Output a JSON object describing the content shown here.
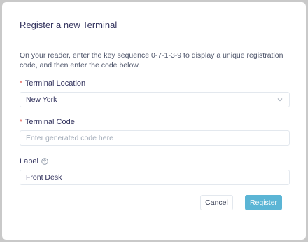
{
  "dialog": {
    "title": "Register a new Terminal",
    "description": "On your reader, enter the key sequence 0-7-1-3-9 to display a unique registration code, and then enter the code below."
  },
  "fields": {
    "location": {
      "label": "Terminal Location",
      "required_mark": "*",
      "value": "New York"
    },
    "code": {
      "label": "Terminal Code",
      "required_mark": "*",
      "placeholder": "Enter generated code here"
    },
    "label": {
      "label": "Label",
      "value": "Front Desk"
    }
  },
  "actions": {
    "cancel_label": "Cancel",
    "register_label": "Register"
  },
  "colors": {
    "primary": "#5bb5d5",
    "required": "#e25950"
  }
}
